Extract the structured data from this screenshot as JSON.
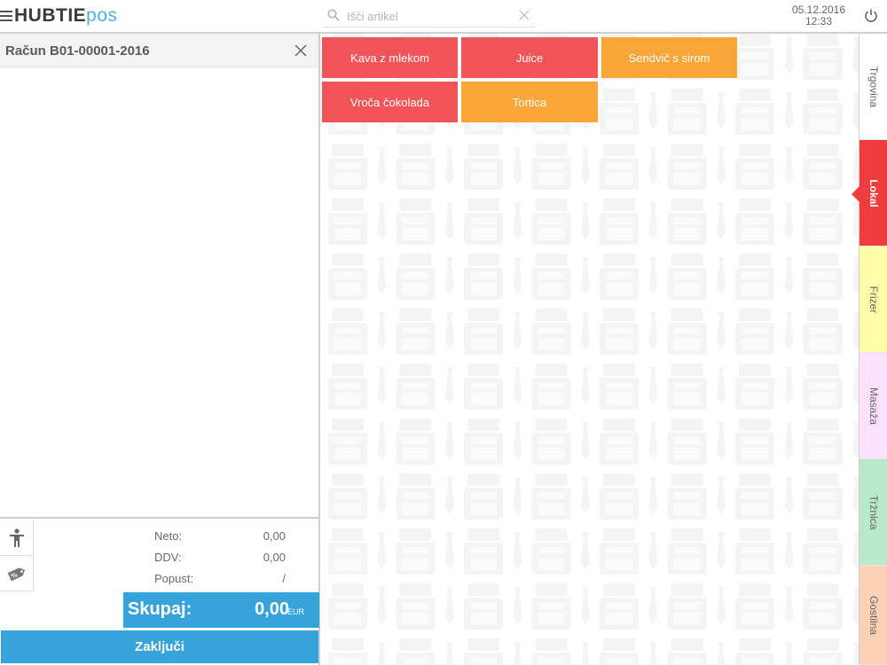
{
  "header": {
    "logo_main": "HUBTIE",
    "logo_sub": "pos",
    "search_placeholder": "Išči artikel",
    "date": "05.12.2016",
    "time": "12:33"
  },
  "receipt": {
    "title": "Račun B01-00001-2016",
    "summary": {
      "neto_label": "Neto:",
      "neto_value": "0,00",
      "ddv_label": "DDV:",
      "ddv_value": "0,00",
      "popust_label": "Popust:",
      "popust_value": "/"
    },
    "total_label": "Skupaj:",
    "total_value": "0,00",
    "currency": "EUR",
    "close_label": "Zaključi"
  },
  "products": [
    {
      "label": "Kava z mlekom",
      "color": "red"
    },
    {
      "label": "Juice",
      "color": "red"
    },
    {
      "label": "Sendvič s sirom",
      "color": "orange"
    },
    {
      "label": "Vroča čokolada",
      "color": "red"
    },
    {
      "label": "Tortica",
      "color": "orange"
    }
  ],
  "categories": [
    {
      "label": "Trgovina",
      "color": "#ffffff",
      "active": false
    },
    {
      "label": "Lokal",
      "color": "#f03c3c",
      "active": true
    },
    {
      "label": "Frizer",
      "color": "#fdfda6",
      "active": false
    },
    {
      "label": "Masaža",
      "color": "#fbe1fb",
      "active": false
    },
    {
      "label": "Tržnica",
      "color": "#b8e9c8",
      "active": false
    },
    {
      "label": "Gostilna",
      "color": "#fcd1b5",
      "active": false
    }
  ],
  "colors": {
    "accent_blue": "#36a3db",
    "tile_red": "#f05458",
    "tile_orange": "#f8a637"
  },
  "icons": {
    "menu": "hamburger-icon",
    "search": "search-icon",
    "clear": "close-icon",
    "power": "power-icon",
    "customer": "person-icon",
    "discount": "discount-tag-icon"
  }
}
